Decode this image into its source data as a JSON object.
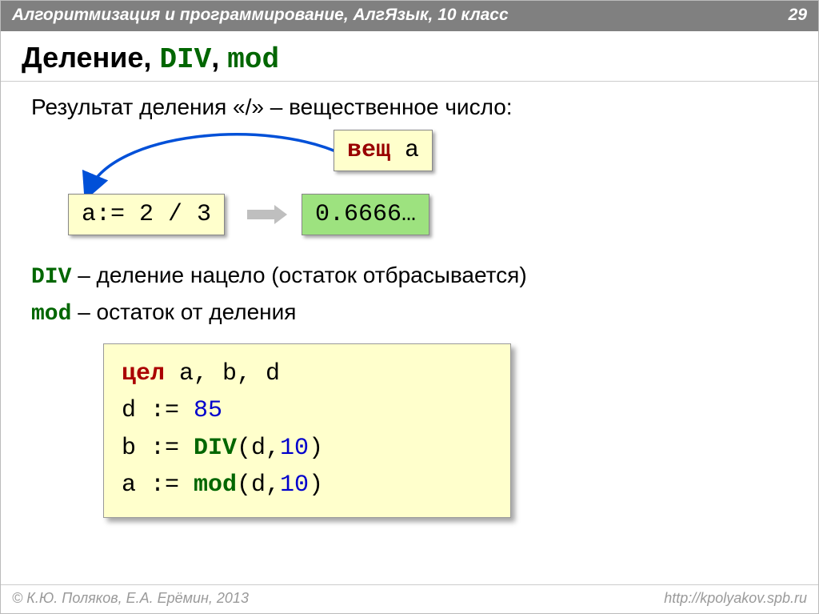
{
  "header": {
    "left": "Алгоритмизация и программирование, АлгЯзык, 10 класс",
    "page": "29"
  },
  "title": {
    "prefix": "Деление",
    "comma1": ", ",
    "kw1": "DIV",
    "comma2": ", ",
    "kw2": "mod"
  },
  "subtitle": "Результат деления «/» – вещественное число:",
  "chips": {
    "vesh_kw": "вещ",
    "vesh_var": " a",
    "expr": "a:= 2 / 3",
    "result": "0.6666…"
  },
  "defs": {
    "div_kw": "DIV",
    "div_txt": " – деление нацело (остаток отбрасывается)",
    "mod_kw": "mod",
    "mod_txt": " – остаток от деления"
  },
  "code": {
    "l1_kw": "цел",
    "l1_rest": " a, b, d",
    "l2_a": "d := ",
    "l2_b": "85",
    "l3_a": "b := ",
    "l3_fn": "DIV",
    "l3_b": "(d,",
    "l3_c": "10",
    "l3_d": ")",
    "l4_a": "a := ",
    "l4_fn": "mod",
    "l4_b": "(d,",
    "l4_c": "10",
    "l4_d": ")"
  },
  "footer": {
    "left": "© К.Ю. Поляков, Е.А. Ерёмин, 2013",
    "right": "http://kpolyakov.spb.ru"
  }
}
